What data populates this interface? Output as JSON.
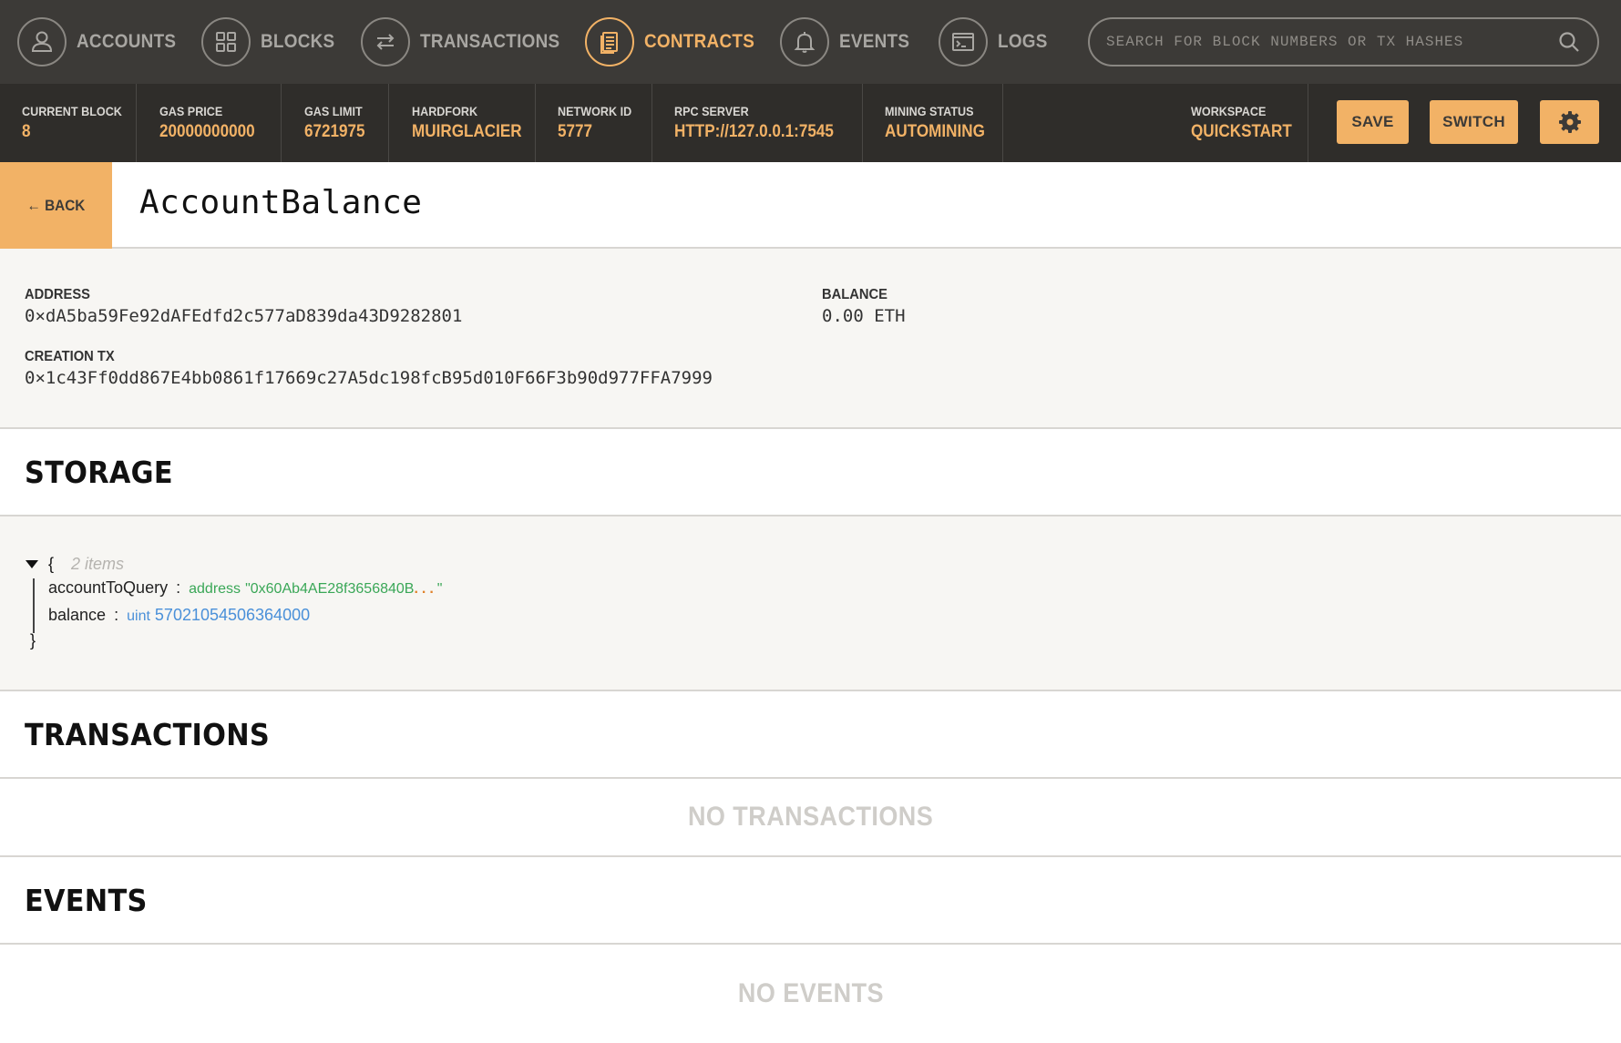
{
  "nav": {
    "items": [
      {
        "label": "ACCOUNTS",
        "icon": "user-icon",
        "active": false
      },
      {
        "label": "BLOCKS",
        "icon": "blocks-icon",
        "active": false
      },
      {
        "label": "TRANSACTIONS",
        "icon": "transfer-icon",
        "active": false
      },
      {
        "label": "CONTRACTS",
        "icon": "document-icon",
        "active": true
      },
      {
        "label": "EVENTS",
        "icon": "bell-icon",
        "active": false
      },
      {
        "label": "LOGS",
        "icon": "terminal-icon",
        "active": false
      }
    ],
    "search_placeholder": "SEARCH FOR BLOCK NUMBERS OR TX HASHES"
  },
  "status": {
    "current_block_label": "CURRENT BLOCK",
    "current_block": "8",
    "gas_price_label": "GAS PRICE",
    "gas_price": "20000000000",
    "gas_limit_label": "GAS LIMIT",
    "gas_limit": "6721975",
    "hardfork_label": "HARDFORK",
    "hardfork": "MUIRGLACIER",
    "network_id_label": "NETWORK ID",
    "network_id": "5777",
    "rpc_server_label": "RPC SERVER",
    "rpc_server": "HTTP://127.0.0.1:7545",
    "mining_status_label": "MINING STATUS",
    "mining_status": "AUTOMINING",
    "workspace_label": "WORKSPACE",
    "workspace": "QUICKSTART",
    "save_label": "SAVE",
    "switch_label": "SWITCH"
  },
  "contract": {
    "back_label": "← BACK",
    "name": "AccountBalance",
    "address_label": "ADDRESS",
    "address": "0×dA5ba59Fe92dAFEdfd2c577aD839da43D9282801",
    "balance_label": "BALANCE",
    "balance": "0.00 ETH",
    "creation_tx_label": "CREATION TX",
    "creation_tx": "0×1c43Ff0dd867E4bb0861f17669c27A5dc198fcB95d010F66F3b90d977FFA7999"
  },
  "storage": {
    "title": "STORAGE",
    "open_brace": "{",
    "close_brace": "}",
    "item_count": "2 items",
    "entries": [
      {
        "key": "accountToQuery",
        "sep": ":",
        "type": "address",
        "value": "\"0x60Ab4AE28f3656840B",
        "ellipsis": "...",
        "close_quote": "\""
      },
      {
        "key": "balance",
        "sep": ":",
        "type": "uint",
        "value": "57021054506364000"
      }
    ]
  },
  "transactions": {
    "title": "TRANSACTIONS",
    "empty": "NO TRANSACTIONS"
  },
  "events": {
    "title": "EVENTS",
    "empty": "NO EVENTS"
  },
  "colors": {
    "accent": "#f2b266",
    "nav_bg": "#3c3a37",
    "status_bg": "#2f2d2a",
    "address_type": "#3aa757",
    "uint_type": "#4a90d9"
  }
}
